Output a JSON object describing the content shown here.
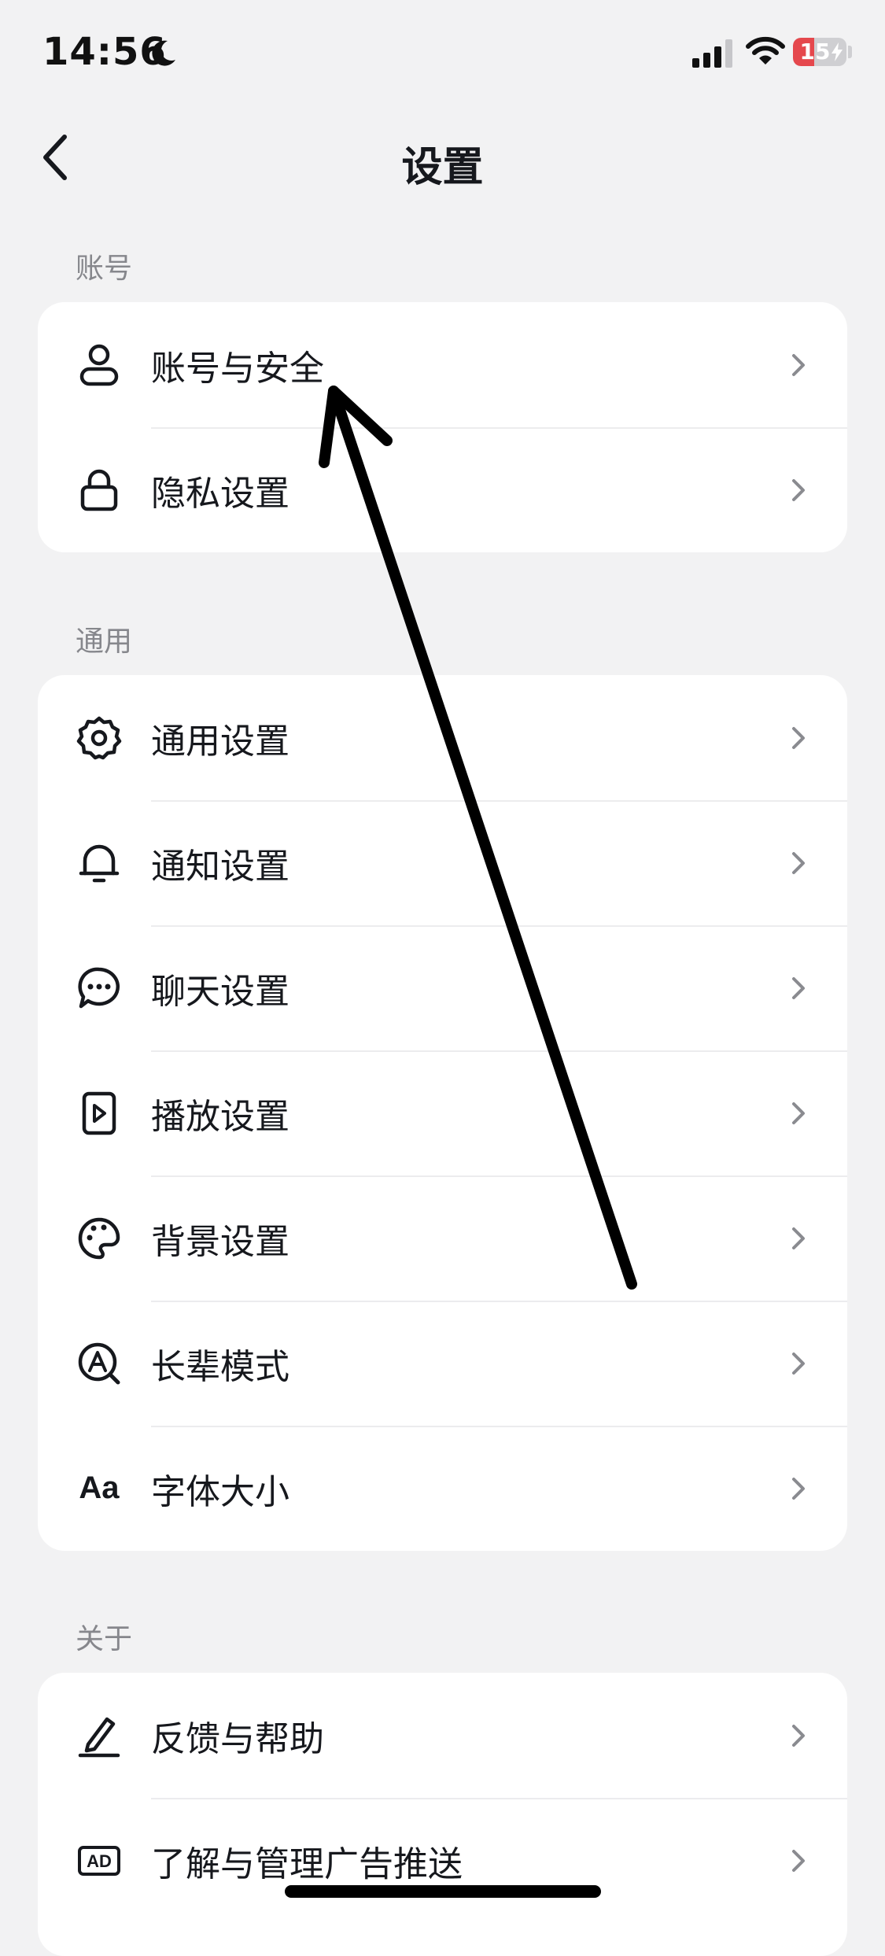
{
  "status_bar": {
    "time": "14:56",
    "battery_level": "15",
    "battery_fraction": 0.15
  },
  "header": {
    "title": "设置"
  },
  "sections": [
    {
      "label": "账号",
      "items": [
        {
          "label": "账号与安全",
          "icon": "user-icon"
        },
        {
          "label": "隐私设置",
          "icon": "lock-icon"
        }
      ]
    },
    {
      "label": "通用",
      "items": [
        {
          "label": "通用设置",
          "icon": "gear-icon"
        },
        {
          "label": "通知设置",
          "icon": "bell-icon"
        },
        {
          "label": "聊天设置",
          "icon": "chat-icon"
        },
        {
          "label": "播放设置",
          "icon": "play-icon"
        },
        {
          "label": "背景设置",
          "icon": "palette-icon"
        },
        {
          "label": "长辈模式",
          "icon": "elder-mode-icon"
        },
        {
          "label": "字体大小",
          "icon": "font-size-icon",
          "icon_text": "Aa"
        }
      ]
    },
    {
      "label": "关于",
      "items": [
        {
          "label": "反馈与帮助",
          "icon": "edit-icon"
        },
        {
          "label": "了解与管理广告推送",
          "icon": "ad-icon",
          "icon_text": "AD"
        }
      ]
    }
  ],
  "colors": {
    "background": "#f2f2f3",
    "card": "#ffffff",
    "text": "#16181d",
    "section_label": "#86878c",
    "chevron": "#8a8b90",
    "battery_low": "#e5484d",
    "annotation": "#000000"
  }
}
